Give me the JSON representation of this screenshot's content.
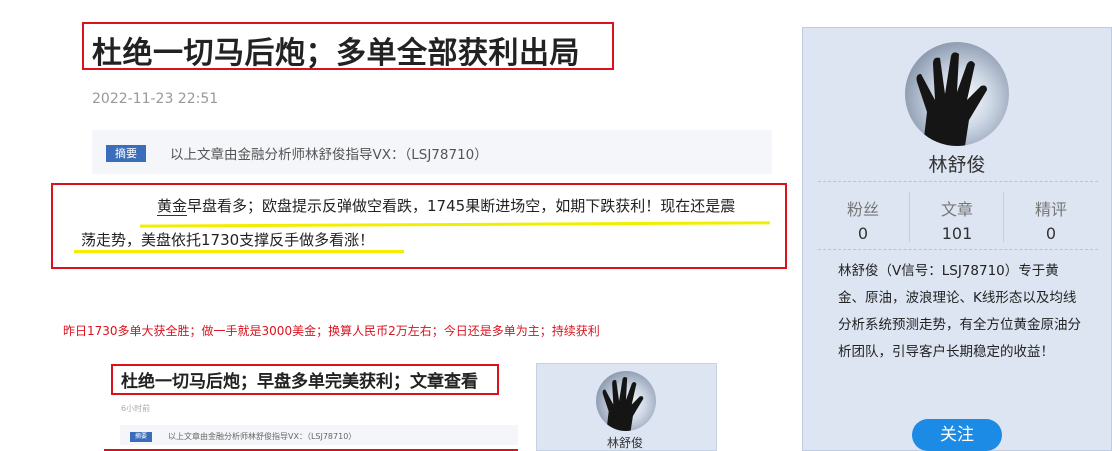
{
  "article": {
    "title": "杜绝一切马后炮；多单全部获利出局",
    "date": "2022-11-23 22:51",
    "summary_tag": "摘要",
    "summary_text": "以上文章由金融分析师林舒俊指导VX：（LSJ78710）",
    "body_link": "黄金",
    "body_line1_rest": "早盘看多；欧盘提示反弹做空看跌，1745果断进场空，如期下跌获利！现在还是震",
    "body_line2": "荡走势，美盘依托1730支撑反手做多看涨！",
    "red_note": "昨日1730多单大获全胜；做一手就是3000美金；换算人民币2万左右；今日还是多单为主；持续获利"
  },
  "embedded_screenshot": {
    "title": "杜绝一切马后炮；早盘多单完美获利；文章查看",
    "date": "6小时前",
    "summary_tag": "摘要",
    "summary_text": "以上文章由金融分析师林舒俊指导VX：（LSJ78710）",
    "author_name": "林舒俊"
  },
  "author_card": {
    "name": "林舒俊",
    "stats": [
      {
        "label": "粉丝",
        "value": "0"
      },
      {
        "label": "文章",
        "value": "101"
      },
      {
        "label": "精评",
        "value": "0"
      }
    ],
    "bio": "林舒俊（V信号：LSJ78710）专于黄金、原油，波浪理论、K线形态以及均线分析系统预测走势，有全方位黄金原油分析团队，引导客户长期稳定的收益！",
    "follow_label": "关注"
  },
  "colors": {
    "highlight_border": "#d9131e",
    "underline_marker": "#f3ee00",
    "card_background": "#dde5f3",
    "follow_button": "#1c8be6",
    "tag_background": "#3b6dbb"
  },
  "icons": {
    "avatar": "hand-silhouette-photo"
  }
}
